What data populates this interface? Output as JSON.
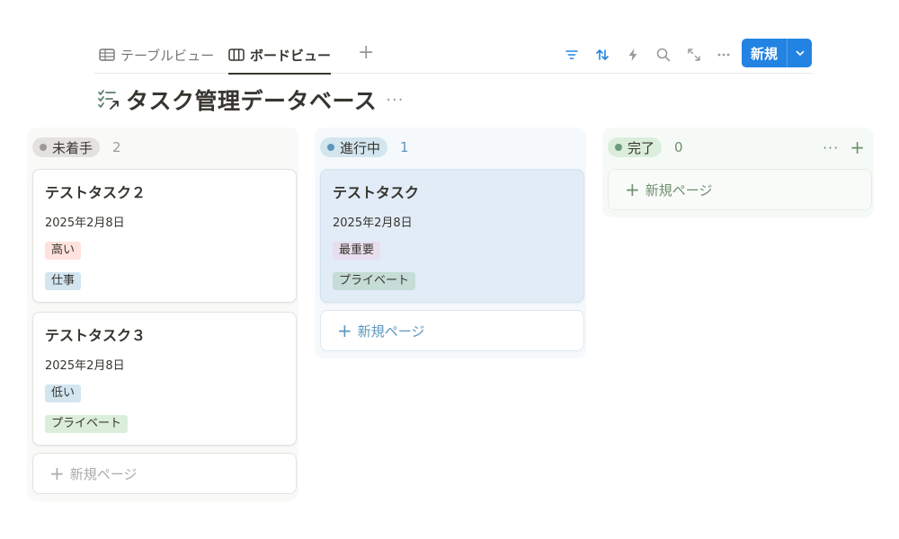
{
  "views": {
    "tabs": [
      {
        "label": "テーブルビュー",
        "icon": "table-icon",
        "active": false
      },
      {
        "label": "ボードビュー",
        "icon": "board-icon",
        "active": true
      }
    ],
    "add_icon": "plus-icon"
  },
  "toolbar": {
    "icons": [
      "filter-icon",
      "sort-icon",
      "automation-icon",
      "search-icon",
      "expand-icon",
      "more-icon"
    ],
    "new_label": "新規"
  },
  "database": {
    "title": "タスク管理データベース",
    "icon": "checklist-icon"
  },
  "columns": [
    {
      "status": "未着手",
      "count": "2",
      "color": "#9b9a97",
      "pill_bg": "#e3e2e0",
      "col_bg": "#f9f9f8",
      "count_color": "#9b9a97",
      "cards": [
        {
          "title": "テストタスク２",
          "date": "2025年2月8日",
          "priority": "高い",
          "priority_bg": "#ffe2dd",
          "category": "仕事",
          "category_bg": "#d3e5ef"
        },
        {
          "title": "テストタスク３",
          "date": "2025年2月8日",
          "priority": "低い",
          "priority_bg": "#d3e5ef",
          "category": "プライベート",
          "category_bg": "#dbeddb"
        }
      ],
      "new_page_label": "新規ページ",
      "new_page_color": "#acaba9"
    },
    {
      "status": "進行中",
      "count": "1",
      "color": "#5b97bd",
      "pill_bg": "#d3e5ef",
      "col_bg": "#f5f9fc",
      "count_color": "#5b97bd",
      "cards": [
        {
          "title": "テストタスク",
          "date": "2025年2月8日",
          "priority": "最重要",
          "priority_bg": "#e8deee",
          "category": "プライベート",
          "category_bg": "#c6dcd6",
          "highlight": true
        }
      ],
      "new_page_label": "新規ページ",
      "new_page_color": "#5b97bd"
    },
    {
      "status": "完了",
      "count": "0",
      "color": "#6c9b7d",
      "pill_bg": "#dbeddb",
      "col_bg": "#f6faf6",
      "count_color": "#6f8f6f",
      "cards": [],
      "new_page_label": "新規ページ",
      "new_page_color": "#6f8f6f"
    }
  ]
}
